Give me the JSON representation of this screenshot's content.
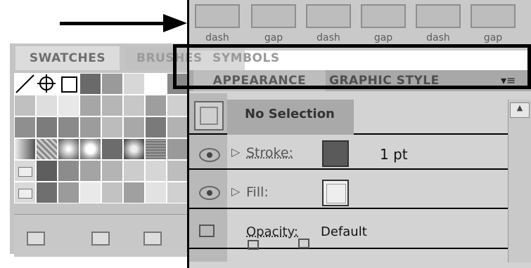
{
  "dash_gap": {
    "labels": [
      "dash",
      "gap",
      "dash",
      "gap",
      "dash",
      "gap"
    ]
  },
  "swatches_panel": {
    "tabs": [
      "SWATCHES",
      "BRUSHES",
      "SYMBOLS"
    ]
  },
  "appearance_panel": {
    "tabs": [
      "APPEARANCE",
      "GRAPHIC STYLE"
    ],
    "menu_icon": "▾≡",
    "no_selection": "No Selection",
    "stroke_label": "Stroke:",
    "stroke_value": "1 pt",
    "fill_label": "Fill:",
    "opacity_label": "Opacity:",
    "opacity_value": "Default"
  },
  "colors": {
    "arrow": "#000000",
    "highlight_border": "#000000",
    "stroke_swatch": "#5a5a5a",
    "fill_swatch": "#eeeeee"
  }
}
